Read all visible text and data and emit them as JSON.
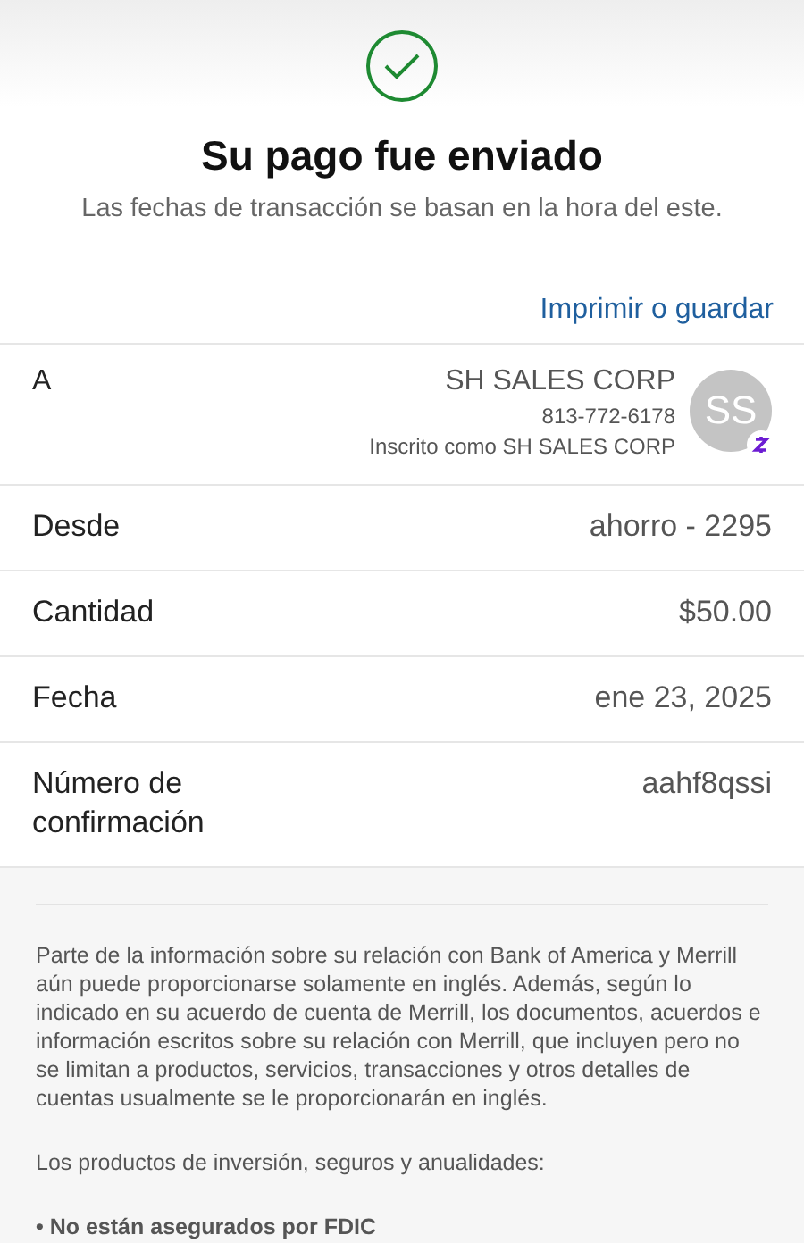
{
  "header": {
    "title": "Su pago fue enviado",
    "subtitle": "Las fechas de transacción se basan en la hora del este.",
    "action": "Imprimir o guardar"
  },
  "recipient": {
    "label": "A",
    "name": "SH SALES CORP",
    "phone": "813-772-6178",
    "enrolled": "Inscrito como SH SALES CORP",
    "initials": "SS"
  },
  "details": [
    {
      "label": "Desde",
      "value": "ahorro - 2295"
    },
    {
      "label": "Cantidad",
      "value": "$50.00"
    },
    {
      "label": "Fecha",
      "value": "ene 23, 2025"
    },
    {
      "label": "Número de confirmación",
      "value": "aahf8qssi"
    }
  ],
  "disclosure": {
    "paragraphs": [
      "Parte de la información sobre su relación con Bank of America y Merrill aún puede proporcionarse solamente en inglés. Además, según lo indicado en su acuerdo de cuenta de Merrill, los documentos, acuerdos e información escritos sobre su relación con Merrill, que incluyen pero no se limitan a productos, servicios, transacciones y otros detalles de cuentas usualmente se le proporcionarán en inglés.",
      "Los productos de inversión, seguros y anualidades:"
    ],
    "bullets": [
      "• No están asegurados por FDIC"
    ]
  }
}
